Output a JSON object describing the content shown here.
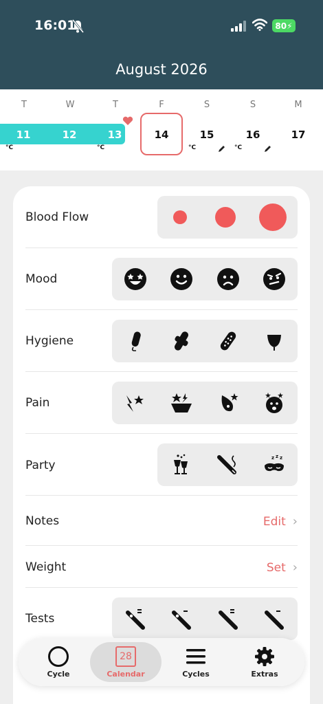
{
  "status": {
    "time": "16:01",
    "battery": "80"
  },
  "header": {
    "title": "August 2026"
  },
  "week": {
    "weekdays": [
      "T",
      "W",
      "T",
      "F",
      "S",
      "S",
      "M"
    ],
    "days": [
      "11",
      "12",
      "13",
      "14",
      "15",
      "16",
      "17"
    ],
    "temp_unit": "°C",
    "selected_day": "14",
    "period_color": "#36d3cf",
    "accent_color": "#e66a6a"
  },
  "sections": {
    "blood_flow": {
      "label": "Blood Flow",
      "icons": [
        "flow-light-icon",
        "flow-medium-icon",
        "flow-heavy-icon"
      ]
    },
    "mood": {
      "label": "Mood",
      "icons": [
        "starry-eyed-icon",
        "smile-icon",
        "sad-icon",
        "angry-icon"
      ]
    },
    "hygiene": {
      "label": "Hygiene",
      "icons": [
        "tampon-icon",
        "pad-icon",
        "panty-liner-icon",
        "menstrual-cup-icon"
      ]
    },
    "pain": {
      "label": "Pain",
      "icons": [
        "cramps-icon",
        "lower-back-pain-icon",
        "breast-pain-icon",
        "headache-icon"
      ]
    },
    "party": {
      "label": "Party",
      "icons": [
        "alcohol-icon",
        "smoking-icon",
        "sleep-mask-icon"
      ]
    },
    "notes": {
      "label": "Notes",
      "action": "Edit"
    },
    "weight": {
      "label": "Weight",
      "action": "Set"
    },
    "tests": {
      "label": "Tests",
      "icons": [
        "pregnancy-test-positive-icon",
        "pregnancy-test-negative-icon",
        "ovulation-test-positive-icon",
        "ovulation-test-negative-icon"
      ]
    }
  },
  "nav": {
    "items": [
      {
        "label": "Cycle",
        "icon": "circle-icon"
      },
      {
        "label": "Calendar",
        "icon": "calendar-icon",
        "badge": "28"
      },
      {
        "label": "Cycles",
        "icon": "menu-icon"
      },
      {
        "label": "Extras",
        "icon": "gear-icon"
      }
    ],
    "active": "Calendar"
  }
}
